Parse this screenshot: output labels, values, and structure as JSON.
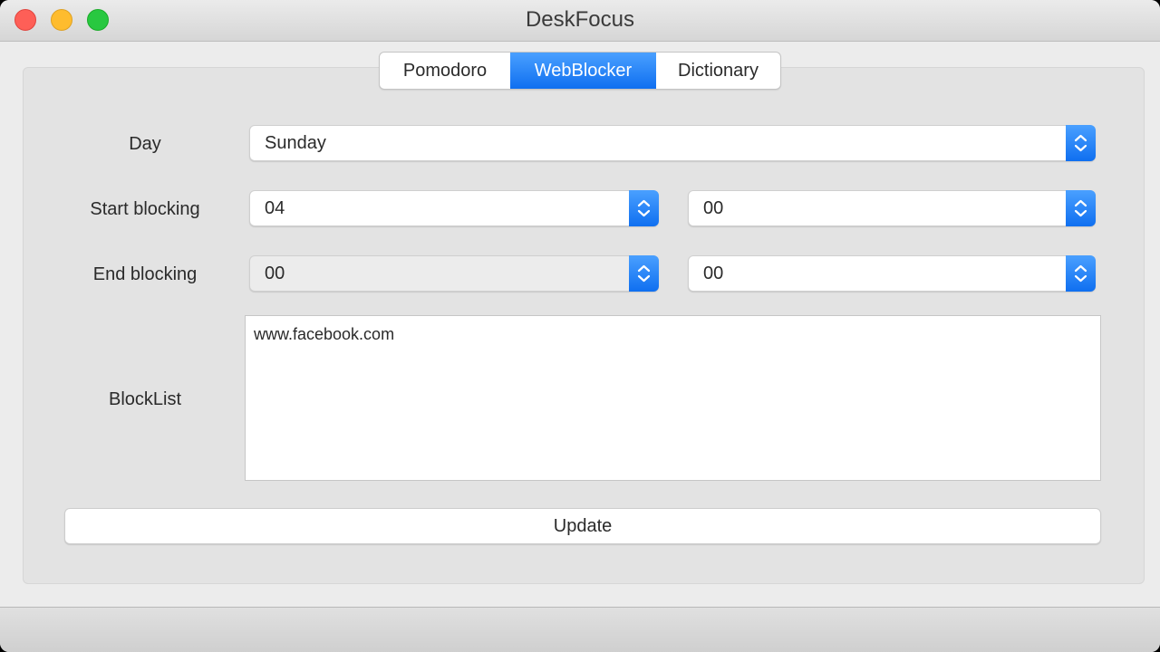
{
  "window": {
    "title": "DeskFocus"
  },
  "tabs": [
    {
      "label": "Pomodoro",
      "active": false
    },
    {
      "label": "WebBlocker",
      "active": true
    },
    {
      "label": "Dictionary",
      "active": false
    }
  ],
  "form": {
    "day_label": "Day",
    "day_value": "Sunday",
    "start_label": "Start blocking",
    "start_hour": "04",
    "start_minute": "00",
    "end_label": "End blocking",
    "end_hour": "00",
    "end_minute": "00",
    "blocklist_label": "BlockList",
    "blocklist_value": "www.facebook.com",
    "update_label": "Update"
  },
  "icons": {
    "stepper": "chevron-up-down-icon"
  },
  "colors": {
    "accent": "#1a7cf7",
    "close": "#fe5f57",
    "minimize": "#febc2e",
    "zoom": "#28c840"
  }
}
